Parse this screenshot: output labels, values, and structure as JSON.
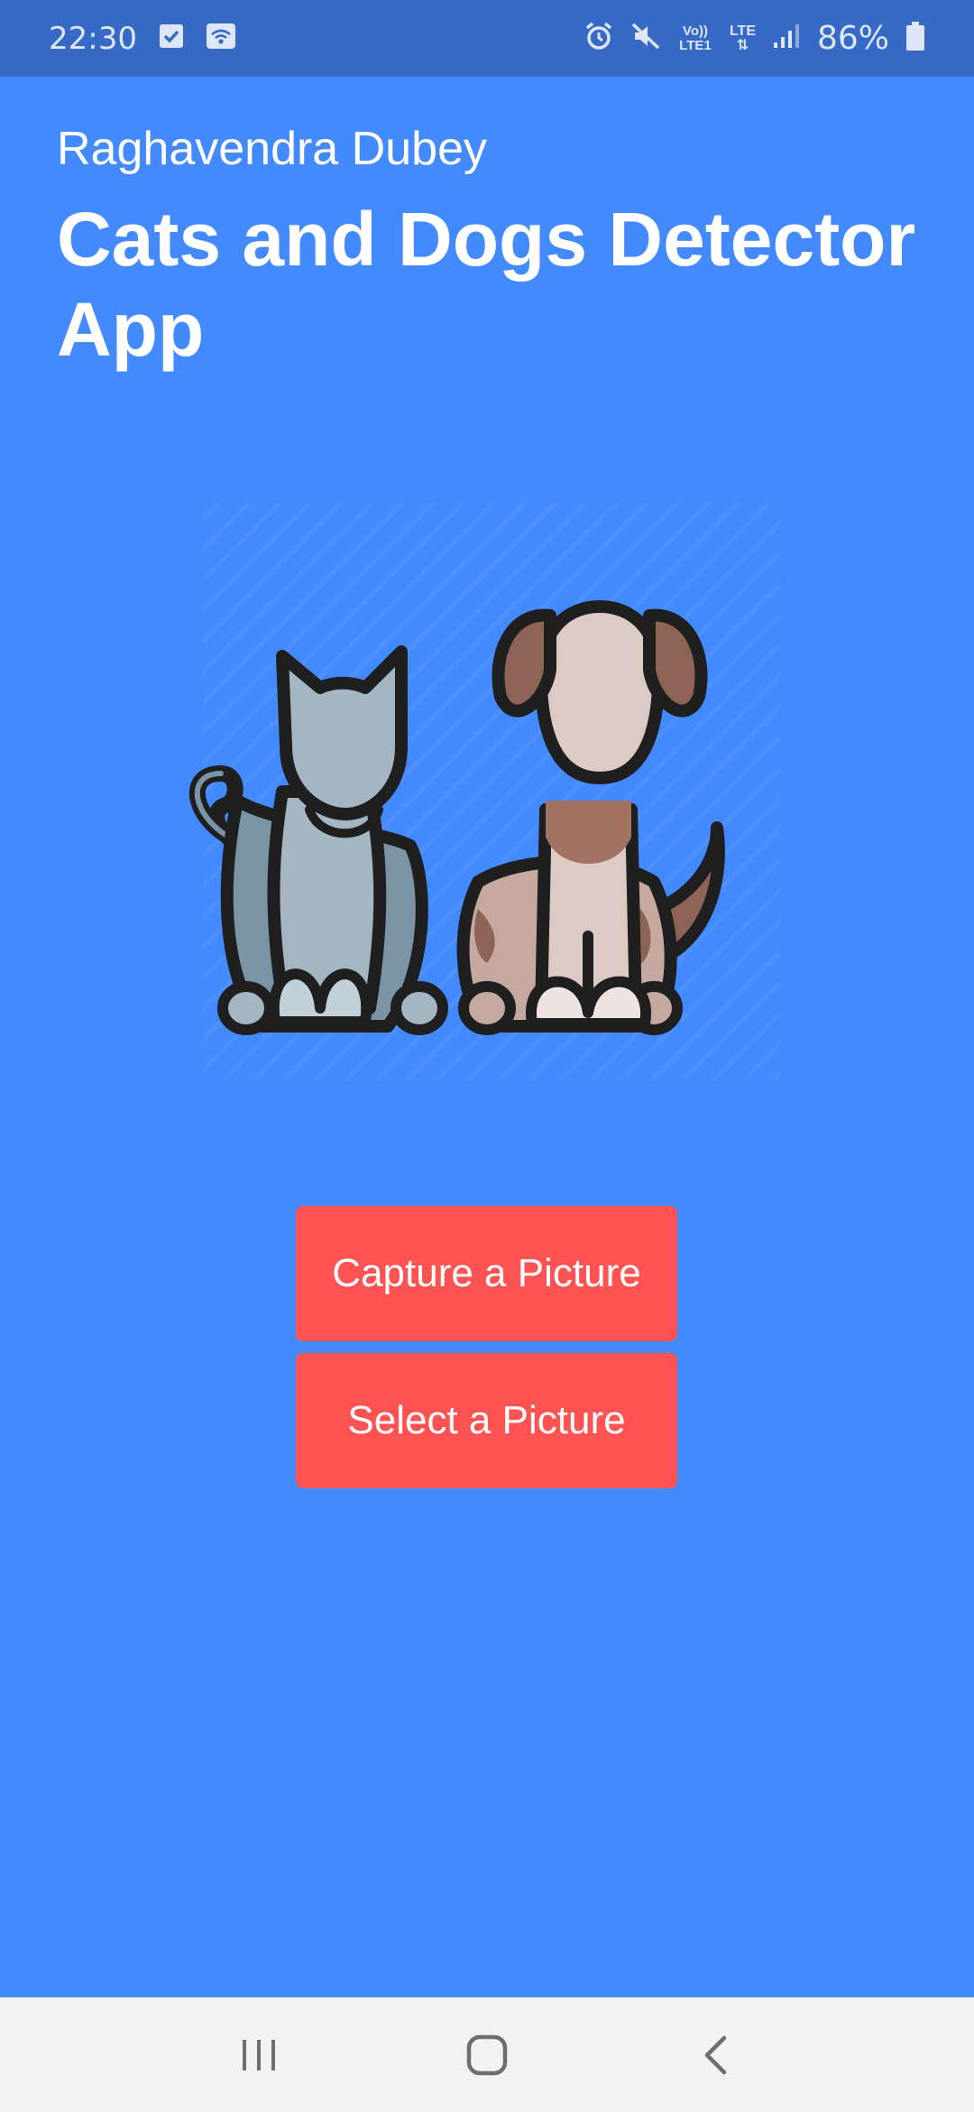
{
  "status_bar": {
    "time": "22:30",
    "lte1": "Vo)) LTE1",
    "lte2": "LTE",
    "battery": "86%"
  },
  "header": {
    "author": "Raghavendra Dubey",
    "title": "Cats and Dogs Detector App"
  },
  "hero": {
    "icon": "cat-and-dog-illustration"
  },
  "actions": {
    "capture_label": "Capture a Picture",
    "select_label": "Select a Picture"
  },
  "colors": {
    "background": "#448aff",
    "status_bar": "#366ac6",
    "button": "#ff5252",
    "nav_bar": "#f2f2f2"
  },
  "nav": {
    "recents_icon": "recents-icon",
    "home_icon": "home-icon",
    "back_icon": "back-icon"
  }
}
